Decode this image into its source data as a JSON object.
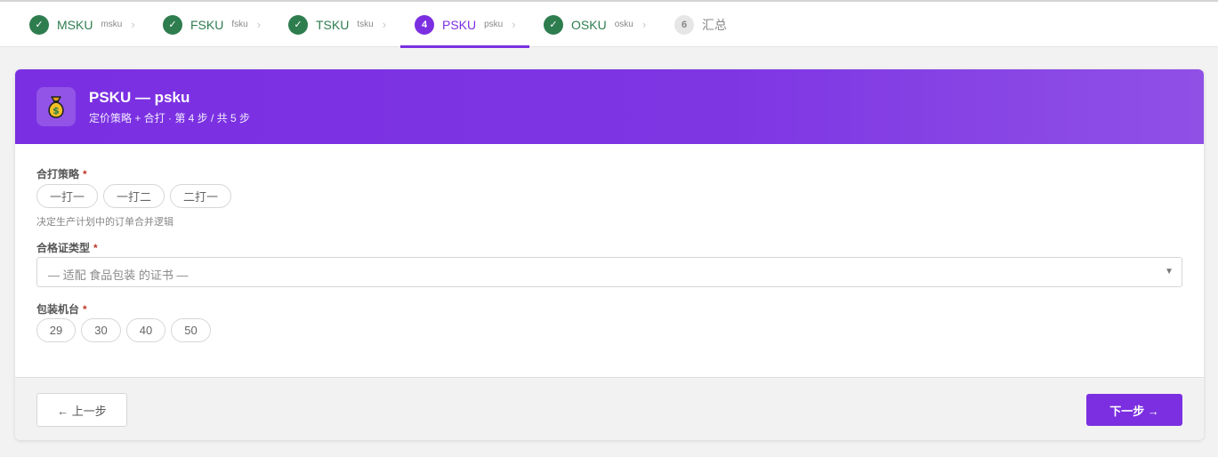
{
  "steps": [
    {
      "label": "MSKU",
      "sub": "msku",
      "state": "done",
      "chevron": "›"
    },
    {
      "label": "FSKU",
      "sub": "fsku",
      "state": "done",
      "chevron": "›"
    },
    {
      "label": "TSKU",
      "sub": "tsku",
      "state": "done",
      "chevron": "›"
    },
    {
      "label": "PSKU",
      "sub": "psku",
      "state": "active",
      "number": "4",
      "chevron": "›"
    },
    {
      "label": "OSKU",
      "sub": "osku",
      "state": "done",
      "chevron": "›"
    },
    {
      "label": "汇总",
      "sub": "",
      "state": "pending",
      "number": "6"
    }
  ],
  "check_symbol": "✓",
  "header": {
    "icon": "money-bag-icon",
    "title": "PSKU — psku",
    "subtitle": "定价策略 + 合打 · 第 4 步 / 共 5 步"
  },
  "fields": {
    "merge_strategy": {
      "label": "合打策略",
      "required_mark": "*",
      "options": [
        "一打一",
        "一打二",
        "二打一"
      ],
      "hint": "决定生产计划中的订单合并逻辑"
    },
    "certificate_type": {
      "label": "合格证类型",
      "required_mark": "*",
      "placeholder": "— 适配 食品包装 的证书 —",
      "arrow": "▼"
    },
    "packing_machine": {
      "label": "包装机台",
      "required_mark": "*",
      "options": [
        "29",
        "30",
        "40",
        "50"
      ]
    }
  },
  "footer": {
    "prev_label": "← 上一步",
    "next_label": "下一步 →"
  },
  "colors": {
    "accent": "#7b2fe0",
    "done": "#2e7d4f",
    "pending": "#888888"
  }
}
